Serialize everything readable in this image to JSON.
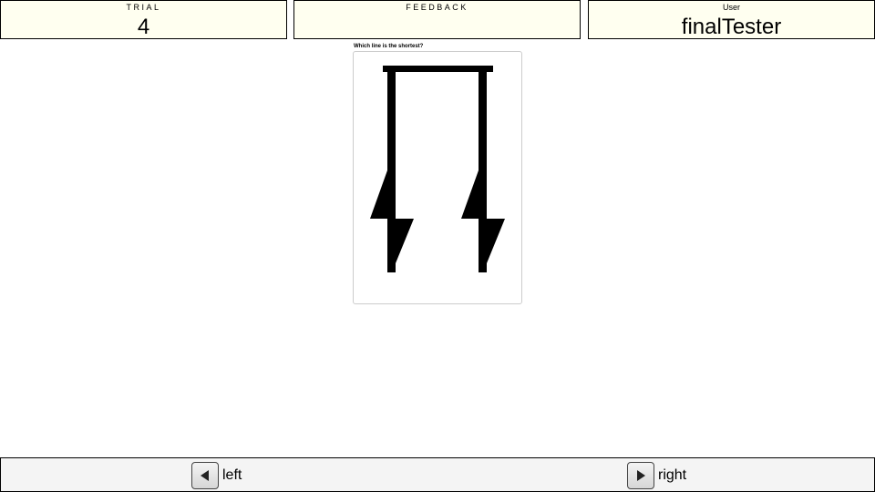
{
  "header": {
    "trial": {
      "label": "TRIAL",
      "value": "4"
    },
    "feedback": {
      "label": "FEEDBACK",
      "value": ""
    },
    "user": {
      "label": "User",
      "value": "finalTester"
    }
  },
  "question": "Which line is the shortest?",
  "stimulus": {
    "description_icon": "two-vertical-lines-with-zigzag-bottoms",
    "color": "#000000"
  },
  "responses": [
    {
      "label": "left",
      "icon": "left-triangle-icon"
    },
    {
      "label": "right",
      "icon": "right-triangle-icon"
    }
  ],
  "colors": {
    "panel_bg": "#fffff0",
    "footer_bg": "#f4f4f4"
  }
}
